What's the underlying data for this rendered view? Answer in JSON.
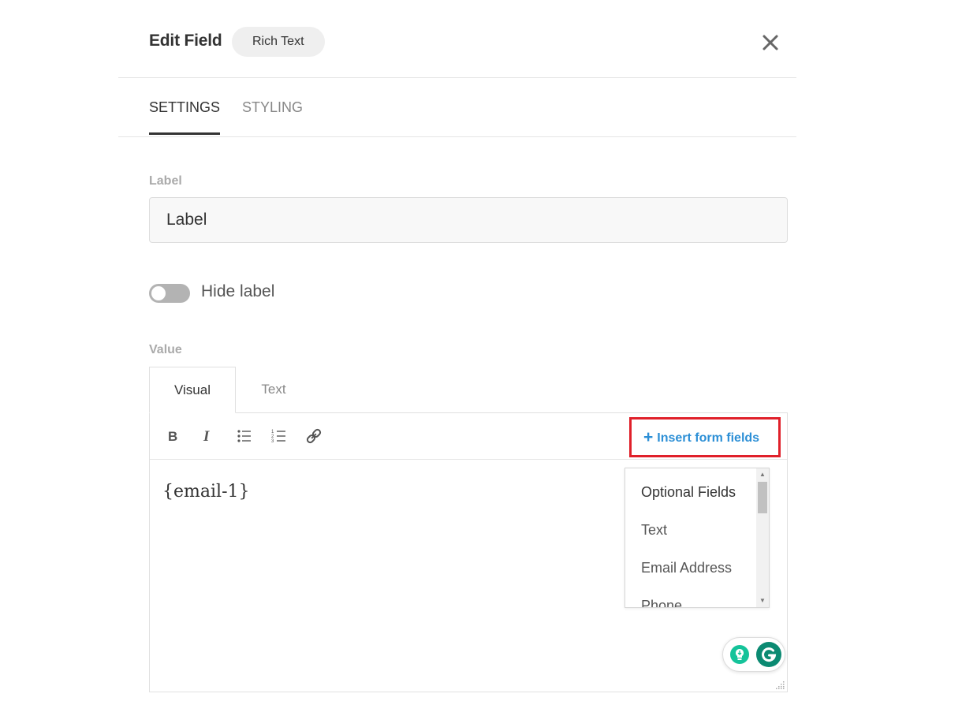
{
  "header": {
    "title": "Edit Field",
    "badge": "Rich Text",
    "close_icon": "close-icon"
  },
  "tabs": {
    "settings": "SETTINGS",
    "styling": "STYLING",
    "active": "SETTINGS"
  },
  "label_field": {
    "label": "Label",
    "value": "Label"
  },
  "hide_label": {
    "text": "Hide label",
    "checked": false
  },
  "value_field": {
    "label": "Value",
    "tabs": {
      "visual": "Visual",
      "text": "Text",
      "active": "Visual"
    },
    "toolbar": {
      "icons": [
        "bold-icon",
        "italic-icon",
        "bulleted-list-icon",
        "numbered-list-icon",
        "link-icon"
      ],
      "insert_label": "Insert form fields",
      "insert_icon": "plus-icon"
    },
    "content": "{email-1}"
  },
  "dropdown": {
    "group": "Optional Fields",
    "items": [
      "Text",
      "Email Address",
      "Phone"
    ]
  },
  "colors": {
    "accent_link": "#2c8fd6",
    "highlight_border": "#e0202a",
    "grammarly": "#0b8a72",
    "toggle_off": "#b3b3b3"
  }
}
